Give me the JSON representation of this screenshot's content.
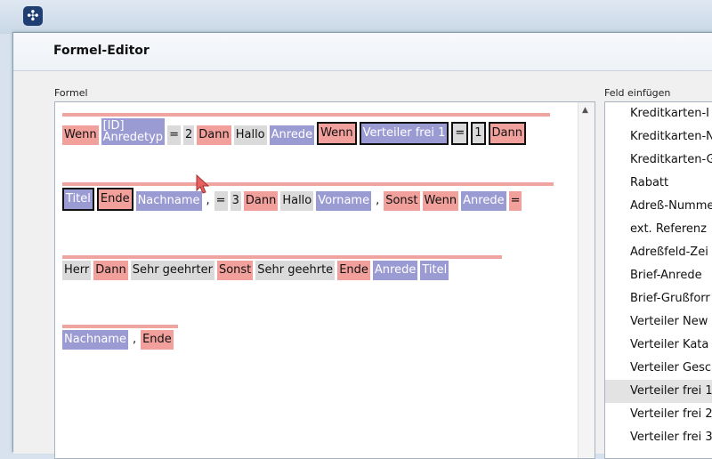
{
  "window": {
    "title": "Formel-Editor"
  },
  "labels": {
    "formula": "Formel",
    "insert_field": "Feld einfügen"
  },
  "formula": {
    "lines": [
      [
        {
          "type": "op",
          "text": "Wenn"
        },
        {
          "type": "field",
          "text": "[ID]\nAnredetyp"
        },
        {
          "type": "literal",
          "text": "="
        },
        {
          "type": "literal",
          "text": "2"
        },
        {
          "type": "op",
          "text": "Dann"
        },
        {
          "type": "literal",
          "text": "Hallo"
        },
        {
          "type": "field",
          "text": "Anrede"
        },
        {
          "type": "op",
          "text": "Wenn",
          "sel": true
        },
        {
          "type": "field",
          "text": "Verteiler frei 1",
          "sel": true
        },
        {
          "type": "literal",
          "text": "=",
          "sel": true
        },
        {
          "type": "literal",
          "text": "1",
          "sel": true
        },
        {
          "type": "op",
          "text": "Dann",
          "sel": true
        }
      ],
      [
        {
          "type": "field",
          "text": "Titel",
          "sel": true
        },
        {
          "type": "op",
          "text": "Ende",
          "sel": true
        },
        {
          "type": "field",
          "text": "Nachname"
        },
        {
          "type": "punct",
          "text": ","
        },
        {
          "type": "literal",
          "text": "="
        },
        {
          "type": "literal",
          "text": "3"
        },
        {
          "type": "op",
          "text": "Dann"
        },
        {
          "type": "literal",
          "text": "Hallo"
        },
        {
          "type": "field",
          "text": "Vorname"
        },
        {
          "type": "punct",
          "text": ","
        },
        {
          "type": "op",
          "text": "Sonst"
        },
        {
          "type": "op",
          "text": "Wenn"
        },
        {
          "type": "field",
          "text": "Anrede"
        },
        {
          "type": "op",
          "text": "="
        }
      ],
      [
        {
          "type": "literal",
          "text": "Herr"
        },
        {
          "type": "op",
          "text": "Dann"
        },
        {
          "type": "literal",
          "text": "Sehr geehrter"
        },
        {
          "type": "op",
          "text": "Sonst"
        },
        {
          "type": "literal",
          "text": "Sehr geehrte"
        },
        {
          "type": "op",
          "text": "Ende"
        },
        {
          "type": "field",
          "text": "Anrede"
        },
        {
          "type": "field",
          "text": "Titel"
        }
      ],
      [
        {
          "type": "field",
          "text": "Nachname"
        },
        {
          "type": "punct",
          "text": ","
        },
        {
          "type": "op",
          "text": "Ende"
        }
      ]
    ]
  },
  "field_list": {
    "selected_index": 12,
    "items": [
      "Kreditkarten-I",
      "Kreditkarten-N",
      "Kreditkarten-G",
      "Rabatt",
      "Adreß-Numme",
      "ext. Referenz",
      "Adreßfeld-Zei",
      "Brief-Anrede",
      "Brief-Grußforr",
      "Verteiler New",
      "Verteiler Kata",
      "Verteiler Gesc",
      "Verteiler frei 1",
      "Verteiler frei 2",
      "Verteiler frei 3"
    ]
  },
  "colors": {
    "operator": "#f2a09c",
    "field": "#9b9bd3",
    "literal": "#dadada"
  }
}
